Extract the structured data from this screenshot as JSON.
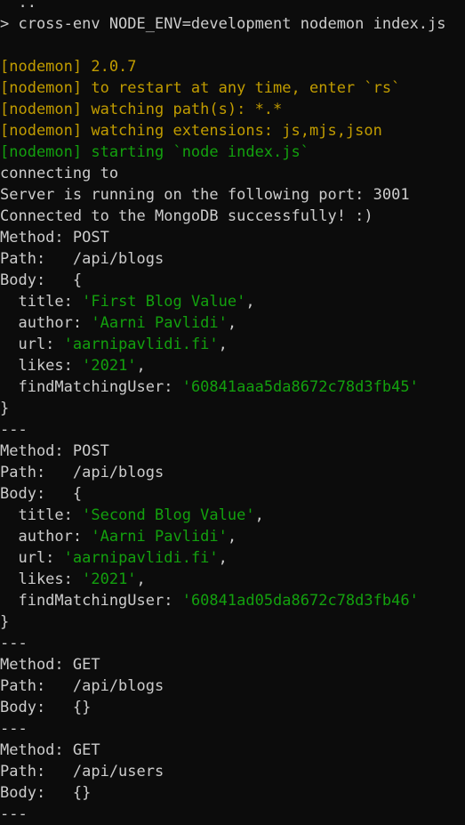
{
  "colors": {
    "background": "#0c0c0c",
    "default": "#cccccc",
    "yellow": "#c19c00",
    "green": "#13a10e"
  },
  "terminal": {
    "lines": [
      {
        "segments": [
          {
            "text": "  ..",
            "color": "default"
          }
        ]
      },
      {
        "segments": [
          {
            "text": "> cross-env NODE_ENV=development nodemon index.js",
            "color": "default"
          }
        ]
      },
      {
        "segments": [
          {
            "text": "",
            "color": "default"
          }
        ]
      },
      {
        "segments": [
          {
            "text": "[nodemon] 2.0.7",
            "color": "yellow"
          }
        ]
      },
      {
        "segments": [
          {
            "text": "[nodemon] to restart at any time, enter `rs`",
            "color": "yellow"
          }
        ]
      },
      {
        "segments": [
          {
            "text": "[nodemon] watching path(s): *.*",
            "color": "yellow"
          }
        ]
      },
      {
        "segments": [
          {
            "text": "[nodemon] watching extensions: js,mjs,json",
            "color": "yellow"
          }
        ]
      },
      {
        "segments": [
          {
            "text": "[nodemon] starting `node index.js`",
            "color": "green"
          }
        ]
      },
      {
        "segments": [
          {
            "text": "connecting to",
            "color": "default"
          }
        ]
      },
      {
        "segments": [
          {
            "text": "Server is running on the following port: 3001",
            "color": "default"
          }
        ]
      },
      {
        "segments": [
          {
            "text": "Connected to the MongoDB successfully! :)",
            "color": "default"
          }
        ]
      },
      {
        "segments": [
          {
            "text": "Method: POST",
            "color": "default"
          }
        ]
      },
      {
        "segments": [
          {
            "text": "Path:   /api/blogs",
            "color": "default"
          }
        ]
      },
      {
        "segments": [
          {
            "text": "Body:   {",
            "color": "default"
          }
        ]
      },
      {
        "segments": [
          {
            "text": "  title: ",
            "color": "default"
          },
          {
            "text": "'First Blog Value'",
            "color": "green"
          },
          {
            "text": ",",
            "color": "default"
          }
        ]
      },
      {
        "segments": [
          {
            "text": "  author: ",
            "color": "default"
          },
          {
            "text": "'Aarni Pavlidi'",
            "color": "green"
          },
          {
            "text": ",",
            "color": "default"
          }
        ]
      },
      {
        "segments": [
          {
            "text": "  url: ",
            "color": "default"
          },
          {
            "text": "'aarnipavlidi.fi'",
            "color": "green"
          },
          {
            "text": ",",
            "color": "default"
          }
        ]
      },
      {
        "segments": [
          {
            "text": "  likes: ",
            "color": "default"
          },
          {
            "text": "'2021'",
            "color": "green"
          },
          {
            "text": ",",
            "color": "default"
          }
        ]
      },
      {
        "segments": [
          {
            "text": "  findMatchingUser: ",
            "color": "default"
          },
          {
            "text": "'60841aaa5da8672c78d3fb45'",
            "color": "green"
          }
        ]
      },
      {
        "segments": [
          {
            "text": "}",
            "color": "default"
          }
        ]
      },
      {
        "segments": [
          {
            "text": "---",
            "color": "default"
          }
        ]
      },
      {
        "segments": [
          {
            "text": "Method: POST",
            "color": "default"
          }
        ]
      },
      {
        "segments": [
          {
            "text": "Path:   /api/blogs",
            "color": "default"
          }
        ]
      },
      {
        "segments": [
          {
            "text": "Body:   {",
            "color": "default"
          }
        ]
      },
      {
        "segments": [
          {
            "text": "  title: ",
            "color": "default"
          },
          {
            "text": "'Second Blog Value'",
            "color": "green"
          },
          {
            "text": ",",
            "color": "default"
          }
        ]
      },
      {
        "segments": [
          {
            "text": "  author: ",
            "color": "default"
          },
          {
            "text": "'Aarni Pavlidi'",
            "color": "green"
          },
          {
            "text": ",",
            "color": "default"
          }
        ]
      },
      {
        "segments": [
          {
            "text": "  url: ",
            "color": "default"
          },
          {
            "text": "'aarnipavlidi.fi'",
            "color": "green"
          },
          {
            "text": ",",
            "color": "default"
          }
        ]
      },
      {
        "segments": [
          {
            "text": "  likes: ",
            "color": "default"
          },
          {
            "text": "'2021'",
            "color": "green"
          },
          {
            "text": ",",
            "color": "default"
          }
        ]
      },
      {
        "segments": [
          {
            "text": "  findMatchingUser: ",
            "color": "default"
          },
          {
            "text": "'60841ad05da8672c78d3fb46'",
            "color": "green"
          }
        ]
      },
      {
        "segments": [
          {
            "text": "}",
            "color": "default"
          }
        ]
      },
      {
        "segments": [
          {
            "text": "---",
            "color": "default"
          }
        ]
      },
      {
        "segments": [
          {
            "text": "Method: GET",
            "color": "default"
          }
        ]
      },
      {
        "segments": [
          {
            "text": "Path:   /api/blogs",
            "color": "default"
          }
        ]
      },
      {
        "segments": [
          {
            "text": "Body:   {}",
            "color": "default"
          }
        ]
      },
      {
        "segments": [
          {
            "text": "---",
            "color": "default"
          }
        ]
      },
      {
        "segments": [
          {
            "text": "Method: GET",
            "color": "default"
          }
        ]
      },
      {
        "segments": [
          {
            "text": "Path:   /api/users",
            "color": "default"
          }
        ]
      },
      {
        "segments": [
          {
            "text": "Body:   {}",
            "color": "default"
          }
        ]
      },
      {
        "segments": [
          {
            "text": "---",
            "color": "default"
          }
        ]
      }
    ]
  }
}
